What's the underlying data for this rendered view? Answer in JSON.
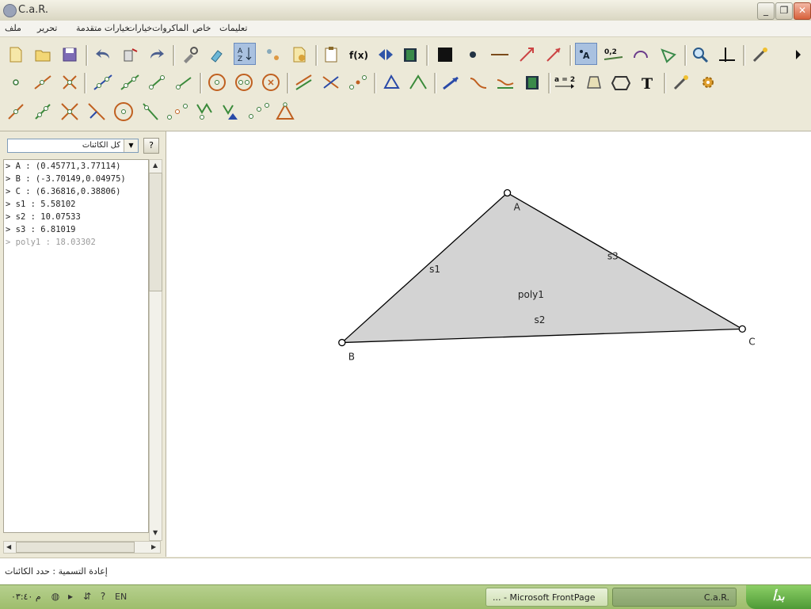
{
  "window": {
    "title": "C.a.R."
  },
  "menu": [
    "تعليمات",
    "خاص",
    "الماكروات",
    "خيارات",
    "خيارات متقدمة",
    "تحرير",
    "ملف"
  ],
  "sidebar": {
    "filter_label": "كل الكائنات",
    "help_label": "?",
    "objects": [
      "> A : (0.45771,3.77114)",
      "> B : (-3.70149,0.04975)",
      "> C : (6.36816,0.38806)",
      "> s1 : 5.58102",
      "> s2 : 10.07533",
      "> s3 : 6.81019",
      "> poly1 : 18.03302"
    ]
  },
  "canvas": {
    "points": [
      {
        "name": "A",
        "x": 0.45771,
        "y": 3.77114
      },
      {
        "name": "B",
        "x": -3.70149,
        "y": 0.04975
      },
      {
        "name": "C",
        "x": 6.36816,
        "y": 0.38806
      }
    ],
    "segments": [
      "s1",
      "s2",
      "s3"
    ],
    "polygon": "poly1",
    "fill_color": "#d3d3d3"
  },
  "status": {
    "text": "إعادة التسمية : حدد الكائنات"
  },
  "taskbar": {
    "clock": "م ٠٣:٤٠",
    "lang": "EN",
    "tasks": [
      "... - Microsoft FrontPage",
      "C.a.R."
    ],
    "start_label": "بدأ"
  }
}
